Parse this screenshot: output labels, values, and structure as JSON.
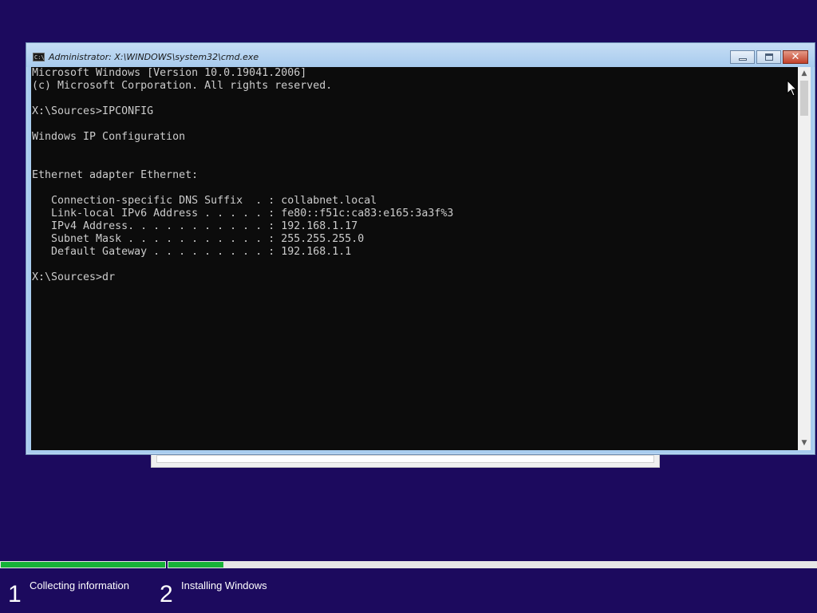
{
  "window": {
    "title": "Administrator: X:\\WINDOWS\\system32\\cmd.exe",
    "icon": "cmd-icon",
    "icon_text": "C:\\",
    "buttons": {
      "minimize": "minimize-icon",
      "maximize": "maximize-icon",
      "close": "✕"
    }
  },
  "console": {
    "lines": [
      "Microsoft Windows [Version 10.0.19041.2006]",
      "(c) Microsoft Corporation. All rights reserved.",
      "",
      "X:\\Sources>IPCONFIG",
      "",
      "Windows IP Configuration",
      "",
      "",
      "Ethernet adapter Ethernet:",
      "",
      "   Connection-specific DNS Suffix  . : collabnet.local",
      "   Link-local IPv6 Address . . . . . : fe80::f51c:ca83:e165:3a3f%3",
      "   IPv4 Address. . . . . . . . . . . : 192.168.1.17",
      "   Subnet Mask . . . . . . . . . . . : 255.255.255.0",
      "   Default Gateway . . . . . . . . . : 192.168.1.1",
      "",
      "X:\\Sources>dr"
    ]
  },
  "scrollbar": {
    "up_icon": "▲",
    "down_icon": "▼"
  },
  "setup": {
    "steps": [
      {
        "number": "1",
        "label": "Collecting information",
        "progress": 1.0
      },
      {
        "number": "2",
        "label": "Installing Windows",
        "progress": 0.085
      }
    ]
  },
  "colors": {
    "desktop_bg": "#1c0a5e",
    "console_bg": "#0c0c0c",
    "console_text": "#cccccc",
    "progress_fill": "#16b238",
    "window_frame": "#a9cdef"
  }
}
